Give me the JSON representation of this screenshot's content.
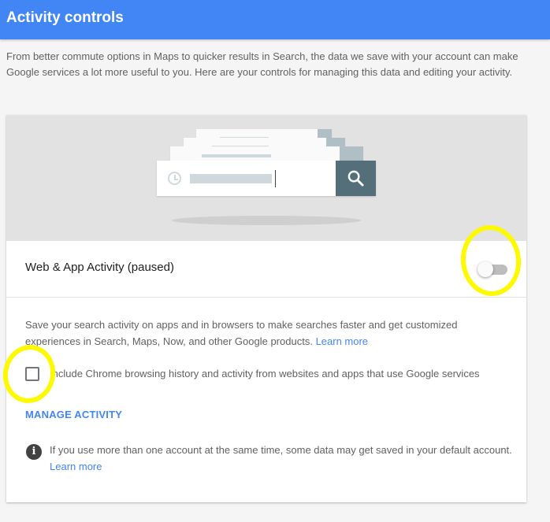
{
  "header": {
    "title": "Activity controls",
    "color": "#4285f4"
  },
  "intro": "From better commute options in Maps to quicker results in Search, the data we save with your account can make Google services a lot more useful to you. Here are your controls for managing this data and editing your activity.",
  "card": {
    "title": "Web & App Activity (paused)",
    "toggle_on": false,
    "description": "Save your search activity on apps and in browsers to make searches faster and get customized experiences in Search, Maps, Now, and other Google products.",
    "learn_more": "Learn more",
    "checkbox_checked": false,
    "checkbox_label": "Include Chrome browsing history and activity from websites and apps that use Google services",
    "manage_label": "MANAGE ACTIVITY",
    "info_text": "If you use more than one account at the same time, some data may get saved in your default account.",
    "info_learn_more": "Learn more"
  },
  "icons": {
    "search": "search-icon",
    "history": "clock-icon",
    "info": "info-icon"
  },
  "annotation_color": "#fdf900"
}
